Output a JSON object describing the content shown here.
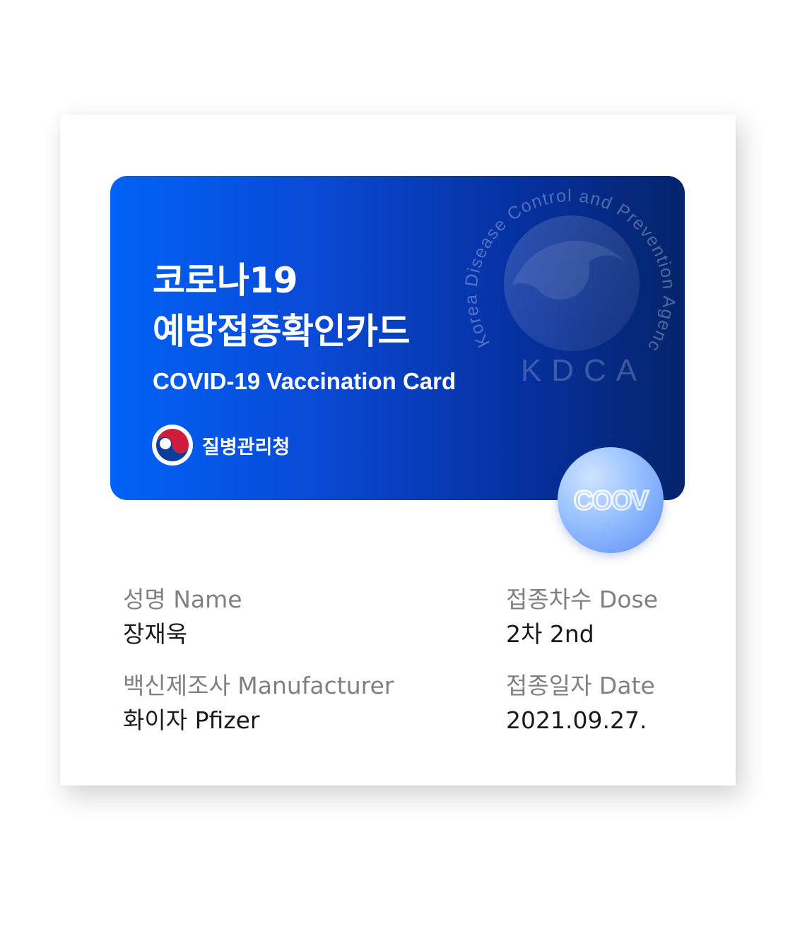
{
  "card": {
    "title_ko_line1": "코로나19",
    "title_ko_line2": "예방접종확인카드",
    "title_en": "COVID-19 Vaccination Card",
    "agency_name": "질병관리청",
    "seal_text": "Korea Disease Control and Prevention Agency",
    "seal_abbr": "KDCA",
    "badge_text": "COOV"
  },
  "fields": {
    "name": {
      "label": "성명 Name",
      "value": "장재욱"
    },
    "dose": {
      "label": "접종차수 Dose",
      "value": "2차 2nd"
    },
    "manufacturer": {
      "label": "백신제조사 Manufacturer",
      "value": "화이자 Pfizer"
    },
    "date": {
      "label": "접종일자 Date",
      "value": "2021.09.27."
    }
  },
  "colors": {
    "card_gradient_start": "#0062f7",
    "card_gradient_end": "#04246a",
    "label_gray": "#808080",
    "value_black": "#1a1a1a",
    "emblem_red": "#d11d3c",
    "emblem_blue": "#0a3d9a"
  },
  "icons": {
    "agency_emblem": "taegeuk-emblem-icon",
    "seal": "kdca-seal-icon",
    "coov_badge": "coov-badge-icon"
  }
}
